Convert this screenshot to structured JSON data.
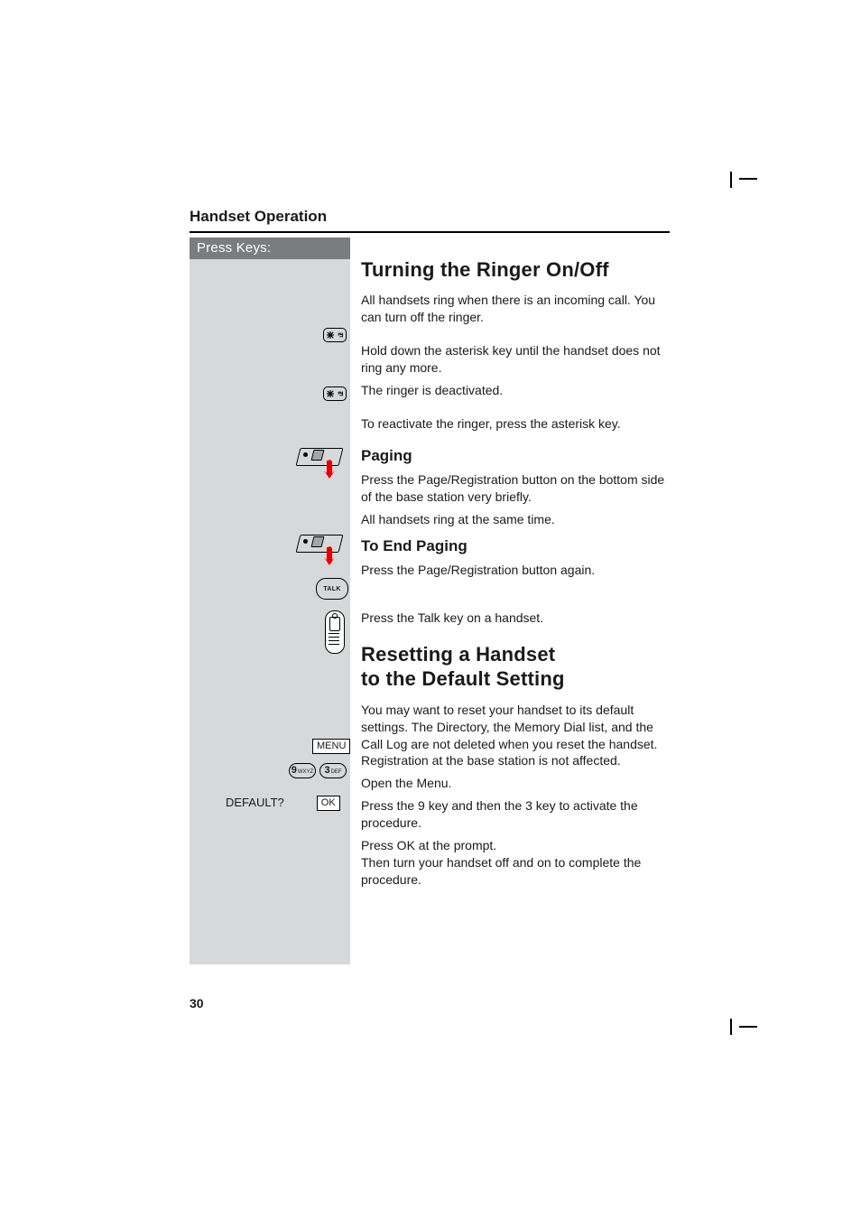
{
  "section_title": "Handset Operation",
  "left": {
    "press_keys": "Press Keys:",
    "menu_label": "MENU",
    "default_label": "DEFAULT?",
    "ok_label": "OK",
    "talk_label": "TALK",
    "key9": {
      "digit": "9",
      "letters": "WXYZ"
    },
    "key3": {
      "digit": "3",
      "letters": "DEF"
    }
  },
  "right": {
    "ringer": {
      "heading": "Turning the Ringer On/Off",
      "intro": "All handsets ring when there is an incoming call. You can turn off the ringer.",
      "hold_down": "Hold down the asterisk key until the handset does not ring any more.",
      "deactivated": "The ringer is deactivated.",
      "reactivate": "To reactivate the ringer, press the asterisk key."
    },
    "paging": {
      "heading": "Paging",
      "press": "Press the Page/Registration button on the bottom side of the base station very briefly.",
      "all_ring": "All handsets ring at the same time."
    },
    "end_paging": {
      "heading": "To End Paging",
      "press_again": "Press the Page/Registration button again.",
      "press_talk": "Press the Talk key on a handset."
    },
    "reset": {
      "heading1": "Resetting a Handset",
      "heading2": "to the Default Setting",
      "intro": "You may want to reset your handset to its default settings. The Directory, the Memory Dial list, and the Call Log are not deleted when you reset the handset. Registration at the base station is not affected.",
      "open_menu": "Open the Menu.",
      "press_93": "Press the 9 key and then the 3 key to activate the procedure.",
      "press_ok": "Press OK at the prompt.\nThen turn your handset off and on to complete the procedure."
    }
  },
  "page_number": "30"
}
